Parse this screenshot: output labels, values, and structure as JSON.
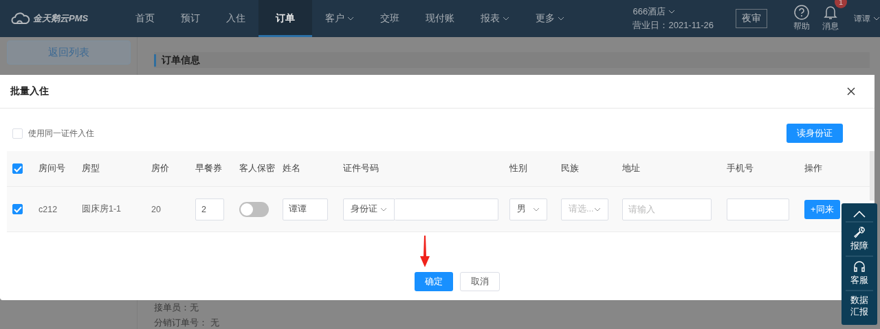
{
  "header": {
    "logo": "金天鹅云PMS",
    "nav": [
      {
        "label": "首页",
        "selected": false,
        "dropdown": false
      },
      {
        "label": "预订",
        "selected": false,
        "dropdown": false
      },
      {
        "label": "入住",
        "selected": false,
        "dropdown": false
      },
      {
        "label": "订单",
        "selected": true,
        "dropdown": false
      },
      {
        "label": "客户",
        "selected": false,
        "dropdown": true
      },
      {
        "label": "交班",
        "selected": false,
        "dropdown": false
      },
      {
        "label": "现付账",
        "selected": false,
        "dropdown": false
      },
      {
        "label": "报表",
        "selected": false,
        "dropdown": true
      },
      {
        "label": "更多",
        "selected": false,
        "dropdown": true
      }
    ],
    "hotel": "666酒店",
    "business_day": "营业日：2021-11-26",
    "night_audit": "夜审",
    "help": "帮助",
    "messages": "消息",
    "message_badge": "1",
    "user": "谭谭"
  },
  "background": {
    "back_button": "返回列表",
    "section_title": "订单信息",
    "lines": [
      "接单员：无",
      "分销订单号： 无"
    ]
  },
  "dialog": {
    "title": "批量入住",
    "same_id": {
      "label": "使用同一证件入住",
      "checked": false
    },
    "read_id_button": "读身份证",
    "table": {
      "all_checked": true,
      "columns": [
        "房间号",
        "房型",
        "房价",
        "早餐券",
        "客人保密",
        "姓名",
        "证件号码",
        "性别",
        "民族",
        "地址",
        "手机号",
        "操作"
      ],
      "rows": [
        {
          "checked": true,
          "cells": [
            {
              "kind": "text",
              "text": "c212"
            },
            {
              "kind": "text",
              "text": "圆床房1-1"
            },
            {
              "kind": "text",
              "text": "20"
            },
            {
              "kind": "input",
              "value": "2"
            },
            {
              "kind": "toggle",
              "on": false
            },
            {
              "kind": "input",
              "value": "谭谭"
            },
            {
              "kind": "id",
              "value": "身份证"
            },
            {
              "kind": "select",
              "value": "男"
            },
            {
              "kind": "select",
              "placeholder": "请选..."
            },
            {
              "kind": "input",
              "placeholder": "请输入"
            },
            {
              "kind": "input"
            },
            {
              "kind": "button",
              "label": "+同来"
            }
          ]
        }
      ]
    },
    "buttons": [
      {
        "label": "确定",
        "kind": "primary"
      },
      {
        "label": "取消",
        "kind": "default"
      }
    ]
  },
  "float_panel": {
    "items": [
      {
        "kind": "top"
      },
      {
        "kind": "wrench",
        "label": "报障"
      },
      {
        "kind": "headset",
        "label": "客服"
      },
      {
        "kind": "text",
        "label": "数据汇报"
      }
    ]
  }
}
